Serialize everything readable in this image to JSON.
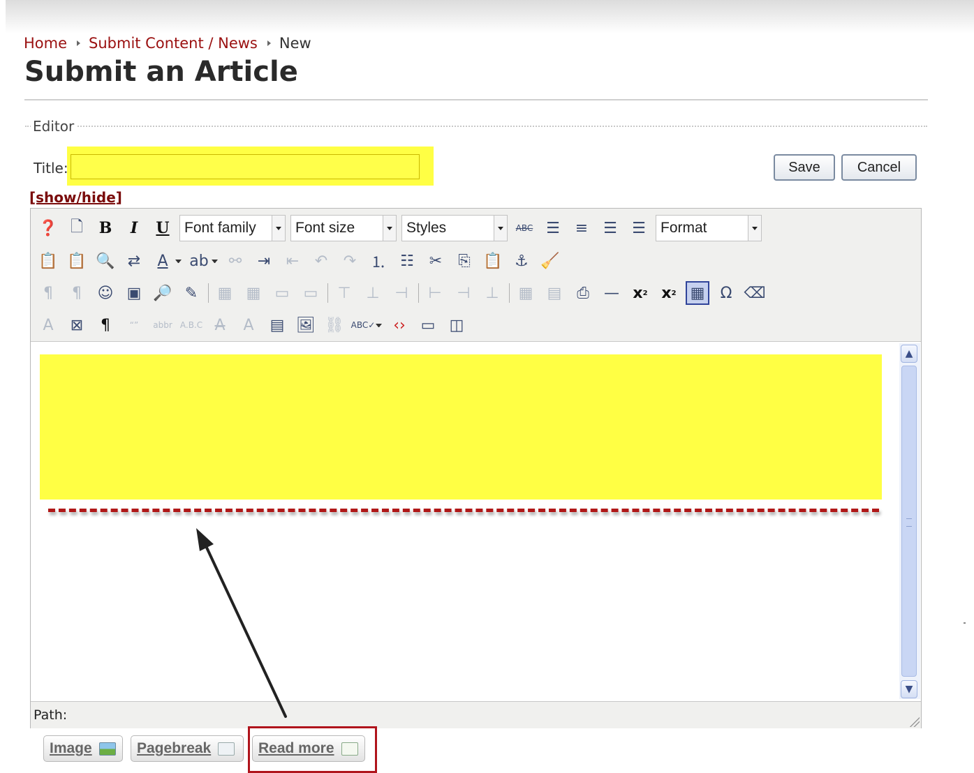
{
  "breadcrumb": {
    "items": [
      "Home",
      "Submit Content / News",
      "New"
    ]
  },
  "page_title": "Submit an Article",
  "fieldset_legend": "Editor",
  "title_field": {
    "label": "Title:",
    "value": ""
  },
  "buttons": {
    "save": "Save",
    "cancel": "Cancel"
  },
  "show_hide": "[show/hide]",
  "toolbar": {
    "font_family": "Font family",
    "font_size": "Font size",
    "styles": "Styles",
    "format": "Format"
  },
  "statusbar": {
    "path_label": "Path:"
  },
  "extra_buttons": {
    "image": "Image",
    "pagebreak": "Pagebreak",
    "read_more": "Read more"
  },
  "colors": {
    "highlight": "#ffff44",
    "annotation_red": "#b0141c",
    "link": "#9a1010"
  }
}
